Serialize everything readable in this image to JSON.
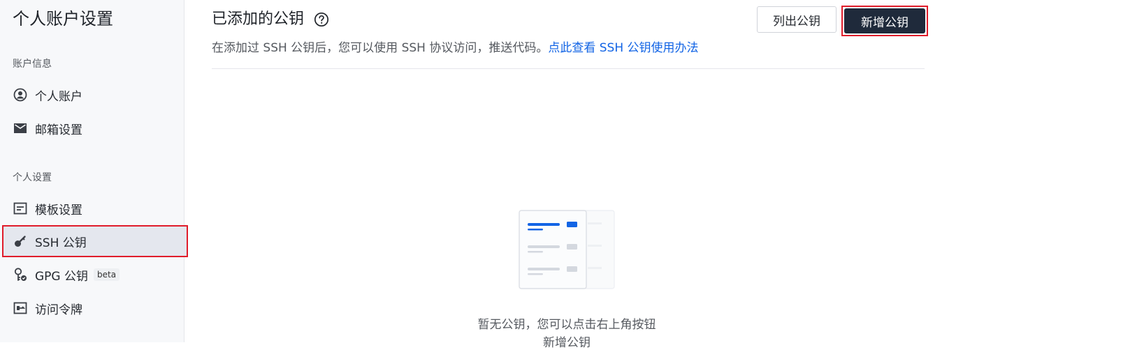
{
  "sidebar": {
    "title": "个人账户设置",
    "groups": [
      {
        "label": "账户信息",
        "items": [
          {
            "label": "个人账户",
            "icon": "user-circle-icon"
          },
          {
            "label": "邮箱设置",
            "icon": "mail-icon"
          }
        ]
      },
      {
        "label": "个人设置",
        "items": [
          {
            "label": "模板设置",
            "icon": "template-icon"
          },
          {
            "label": "SSH 公钥",
            "icon": "key-icon",
            "active": true
          },
          {
            "label": "GPG 公钥",
            "icon": "gpg-key-icon",
            "badge": "beta"
          },
          {
            "label": "访问令牌",
            "icon": "token-icon"
          }
        ]
      }
    ]
  },
  "main": {
    "title": "已添加的公钥",
    "description": "在添加过 SSH 公钥后，您可以使用 SSH 协议访问，推送代码。",
    "help_link": "点此查看 SSH 公钥使用办法",
    "list_button": "列出公钥",
    "add_button": "新增公钥",
    "empty_state": {
      "line1": "暂无公钥，您可以点击右上角按钮",
      "line2": "新增公钥"
    }
  },
  "colors": {
    "accent": "#1264e5",
    "primary_button": "#1f2a3b",
    "highlight_border": "#e01c2a",
    "sidebar_bg": "#f7f8fa"
  }
}
